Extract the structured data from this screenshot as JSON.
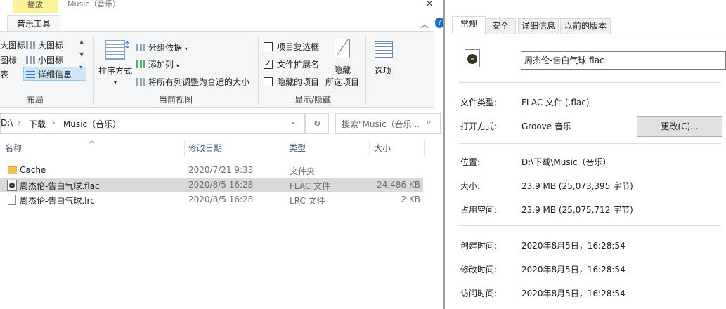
{
  "explorer": {
    "title_tab": "播放",
    "window_title": "Music（音乐）",
    "ribbon_tab": "音乐工具",
    "layout_group": {
      "items": [
        "大图标",
        "大图标",
        "小图标",
        "详细信息"
      ],
      "partial_labels": [
        "图标",
        "表"
      ],
      "label": "布局"
    },
    "view_group": {
      "sort_label": "排序方式",
      "group_by": "分组依据",
      "add_column": "添加列",
      "fit_columns": "将所有列调整为合适的大小",
      "label": "当前视图"
    },
    "show_hide": {
      "checkbox_items": [
        "项目复选框",
        "文件扩展名",
        "隐藏的项目"
      ],
      "checked": [
        false,
        true,
        false
      ],
      "hide_selected_line1": "隐藏",
      "hide_selected_line2": "所选项目",
      "options": "选项",
      "label": "显示/隐藏"
    },
    "address": {
      "segments": [
        "D:\\",
        "下载",
        "Music（音乐）"
      ]
    },
    "search_placeholder": "搜索\"Music（音乐...",
    "columns": [
      "名称",
      "修改日期",
      "类型",
      "大小"
    ],
    "files": [
      {
        "name": "Cache",
        "date": "2020/7/21 9:33",
        "type": "文件夹",
        "size": "",
        "icon": "folder-icon",
        "selected": false
      },
      {
        "name": "周杰伦-告白气球.flac",
        "date": "2020/8/5 16:28",
        "type": "FLAC 文件",
        "size": "24,486 KB",
        "icon": "audio-file-icon",
        "selected": true
      },
      {
        "name": "周杰伦-告白气球.lrc",
        "date": "2020/8/5 16:28",
        "type": "LRC 文件",
        "size": "2 KB",
        "icon": "text-file-icon",
        "selected": false
      }
    ]
  },
  "properties": {
    "tabs": [
      "常规",
      "安全",
      "详细信息",
      "以前的版本"
    ],
    "filename": "周杰伦-告白气球.flac",
    "file_type_label": "文件类型:",
    "file_type_value": "FLAC 文件 (.flac)",
    "open_with_label": "打开方式:",
    "open_with_value": "Groove 音乐",
    "change_button": "更改(C)...",
    "location_label": "位置:",
    "location_value": "D:\\下载\\Music（音乐）",
    "size_label": "大小:",
    "size_value": "23.9 MB (25,073,395 字节)",
    "disk_size_label": "占用空间:",
    "disk_size_value": "23.9 MB (25,075,712 字节)",
    "created_label": "创建时间:",
    "created_value": "2020年8月5日，16:28:54",
    "modified_label": "修改时间:",
    "modified_value": "2020年8月5日，16:28:54",
    "accessed_label": "访问时间:",
    "accessed_value": "2020年8月5日，16:28:54"
  }
}
